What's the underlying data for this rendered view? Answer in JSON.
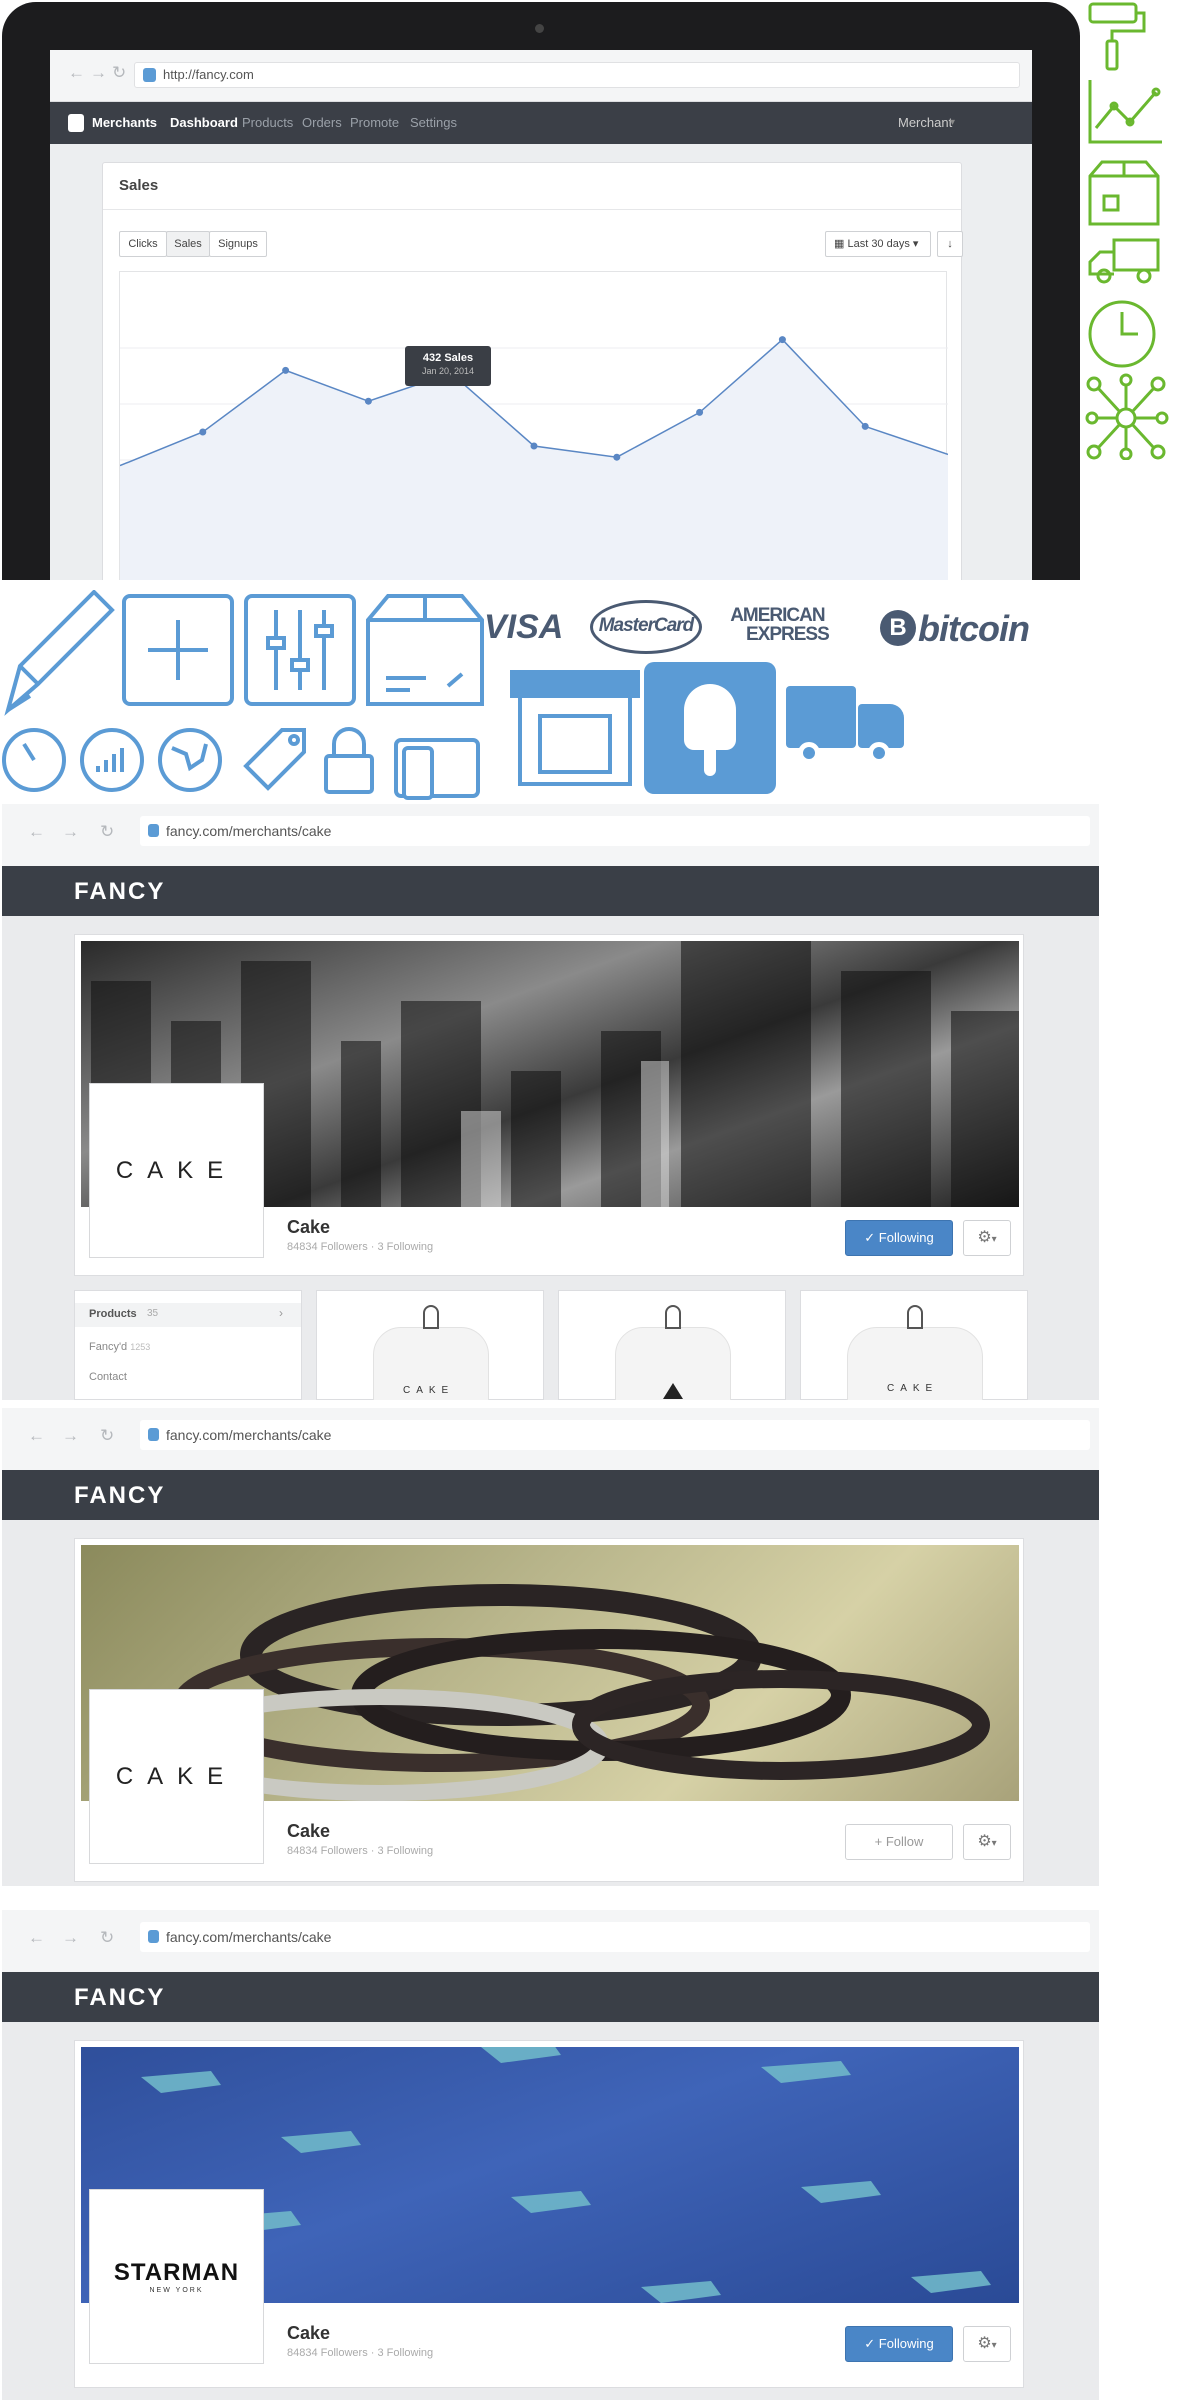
{
  "laptop": {
    "url": "http://fancy.com",
    "brand": "Merchants",
    "nav": [
      "Dashboard",
      "Products",
      "Orders",
      "Promote",
      "Settings"
    ],
    "user_menu": "Merchant",
    "card_title": "Sales",
    "segments": [
      "Clicks",
      "Sales",
      "Signups"
    ],
    "range": "Last 30 days",
    "tooltip_title": "432 Sales",
    "tooltip_date": "Jan 20, 2014"
  },
  "chart_data": {
    "type": "area",
    "title": "",
    "xlabel": "",
    "ylabel": "",
    "values": [
      190,
      250,
      360,
      305,
      355,
      225,
      205,
      285,
      415,
      260,
      210
    ],
    "highlight_index": 4,
    "ylim": [
      0,
      500
    ],
    "grid": true,
    "color": "#5a87c4"
  },
  "payments": {
    "visa": "VISA",
    "mastercard": "MasterCard",
    "amex_line1": "AMERICAN",
    "amex_line2": "EXPRESS",
    "bitcoin": "bitcoin"
  },
  "colors": {
    "green_icons": "#6ab82f",
    "blue_icons": "#5b9bd5",
    "fancy_bar": "#3a3f47"
  },
  "panels": [
    {
      "url": "fancy.com/merchants/cake",
      "brand": "FANCY",
      "logo_text": "CAKE",
      "name": "Cake",
      "stats": "84834 Followers · 3 Following",
      "follow_label": "✓ Following",
      "follow_state": "following",
      "sidebar": [
        {
          "label": "Products",
          "count": "35"
        },
        {
          "label": "Fancy'd",
          "count": "1253"
        },
        {
          "label": "Contact",
          "count": ""
        }
      ],
      "product_tag": "CAKE"
    },
    {
      "url": "fancy.com/merchants/cake",
      "brand": "FANCY",
      "logo_text": "CAKE",
      "name": "Cake",
      "stats": "84834 Followers · 3 Following",
      "follow_label": "+ Follow",
      "follow_state": "not-following"
    },
    {
      "url": "fancy.com/merchants/cake",
      "brand": "FANCY",
      "logo_text": "STARMAN",
      "logo_sub": "NEW YORK",
      "name": "Cake",
      "stats": "84834 Followers · 3 Following",
      "follow_label": "✓ Following",
      "follow_state": "following"
    }
  ]
}
